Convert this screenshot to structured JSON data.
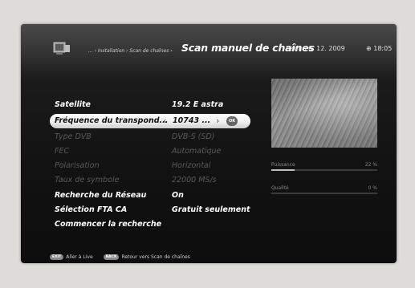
{
  "header": {
    "breadcrumb": "... › Installation › Scan de chaînes ›",
    "title": "Scan manuel de chaînes",
    "date": "Sam, 26. 12. 2009",
    "time": "⊕ 18:05"
  },
  "menu": {
    "items": [
      {
        "label": "Satellite",
        "value": "19.2 E astra"
      },
      {
        "label": "Fréquence du transpond...",
        "value": "10743 ..."
      },
      {
        "label": "Type DVB",
        "value": "DVB-S (SD)"
      },
      {
        "label": "FEC",
        "value": "Automatique"
      },
      {
        "label": "Polarisation",
        "value": "Horizontal"
      },
      {
        "label": "Taux de symbole",
        "value": "22000 MS/s"
      },
      {
        "label": "Recherche du Réseau",
        "value": "On"
      },
      {
        "label": "Sélection FTA CA",
        "value": "Gratuit seulement"
      },
      {
        "label": "Commencer la recherche",
        "value": ""
      }
    ],
    "ok_label": "OK",
    "arrow_left": "‹",
    "arrow_right": "›"
  },
  "signal": {
    "power_label": "Puissance",
    "power_value": "22 %",
    "power_fraction": 0.22,
    "quality_label": "Qualité",
    "quality_value": "0 %",
    "quality_fraction": 0.0
  },
  "footer": {
    "exit_key": "EXIT",
    "exit_text": "Aller à Live",
    "back_key": "BACK",
    "back_text": "Retour vers Scan de chaînes"
  }
}
